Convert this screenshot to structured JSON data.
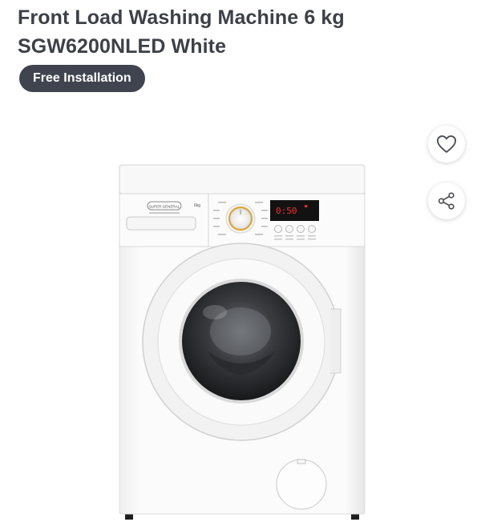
{
  "product": {
    "title": "Front Load Washing Machine 6 kg SGW6200NLED White",
    "badge": "Free Installation"
  },
  "image": {
    "alt": "Front load washing machine",
    "display_text": "0:50",
    "capacity_label": "6kg",
    "brand_logo": "SUPER GENERAL"
  },
  "actions": {
    "wishlist_icon": "heart-icon",
    "share_icon": "share-icon"
  },
  "colors": {
    "title": "#3d4047",
    "badge_bg": "#3f444f",
    "display_digits": "#ff2a2a"
  }
}
